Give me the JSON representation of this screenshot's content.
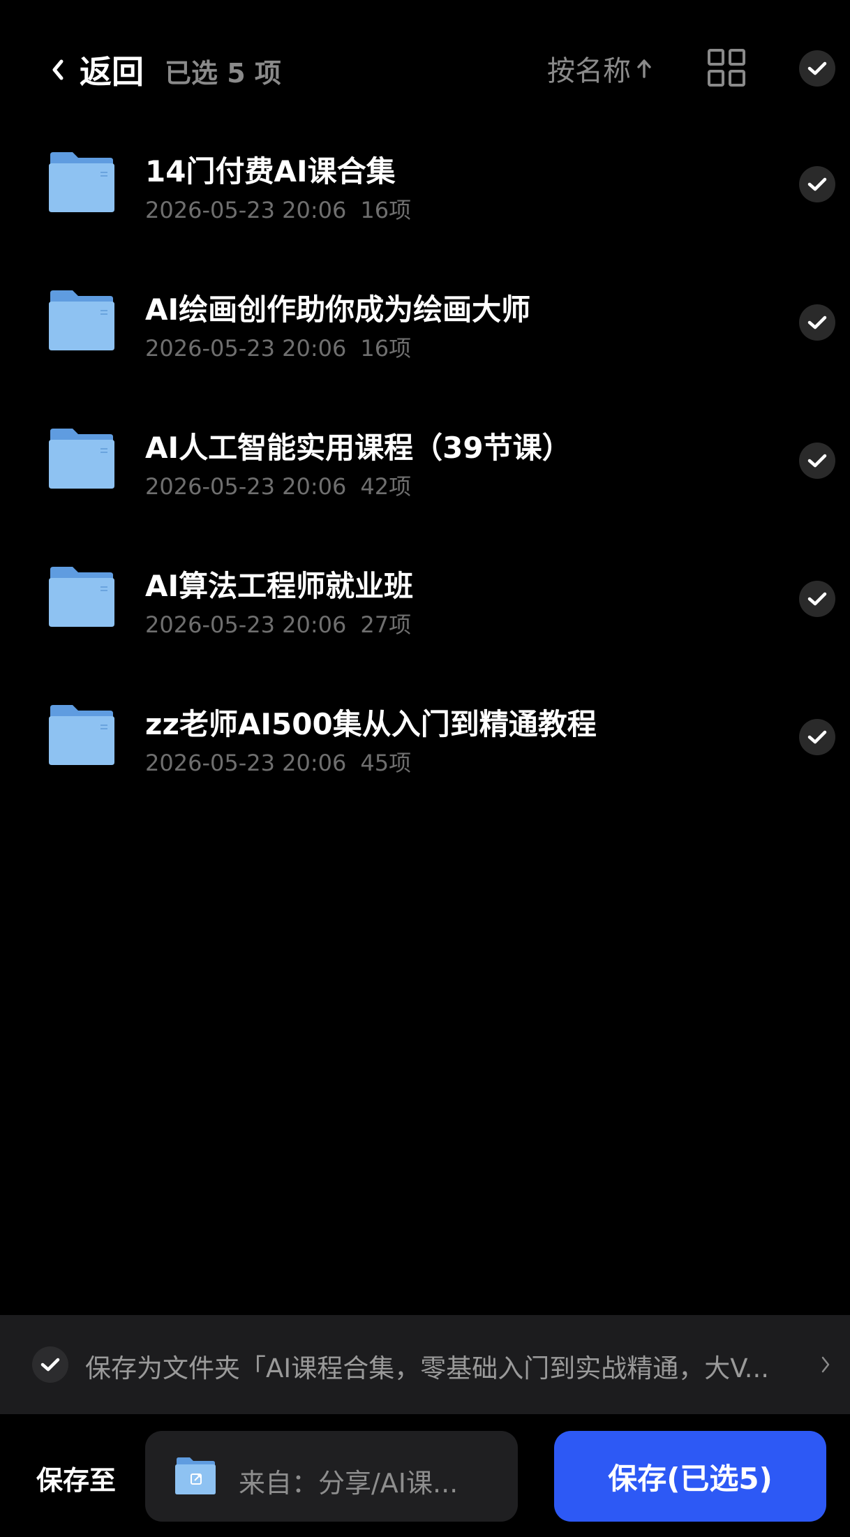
{
  "header": {
    "back_label": "返回",
    "selected_count": "已选 5 项",
    "sort_label": "按名称",
    "sort_direction_icon": "arrow-up-icon",
    "view_toggle_icon": "grid-view-icon",
    "select_all_icon": "check-icon"
  },
  "items": [
    {
      "name": "14门付费AI课合集",
      "date": "2026-05-23 20:06",
      "count": "16项",
      "checked": true
    },
    {
      "name": " AI绘画创作助你成为绘画大师",
      "date": "2026-05-23 20:06",
      "count": "16项",
      "checked": true
    },
    {
      "name": "AI人工智能实用课程（39节课）",
      "date": "2026-05-23 20:06",
      "count": "42项",
      "checked": true
    },
    {
      "name": "AI算法工程师就业班",
      "date": "2026-05-23 20:06",
      "count": "27项",
      "checked": true
    },
    {
      "name": "zz老师AI500集从入门到精通教程",
      "date": "2026-05-23 20:06",
      "count": "45项",
      "checked": true
    }
  ],
  "save_as_folder": {
    "text": "保存为文件夹「AI课程合集，零基础入门到实战精通，大V...",
    "checked": true
  },
  "footer": {
    "save_to_label": "保存至",
    "destination": "来自：分享/AI课...",
    "save_button_label": "保存(已选5)"
  },
  "colors": {
    "background": "#000000",
    "accent_blue": "#2d59f5",
    "folder_blue": "#7fb8ee",
    "secondary_text": "#8a8a8a",
    "meta_text": "#6f6f6f",
    "bar_background": "#1c1c1e"
  }
}
